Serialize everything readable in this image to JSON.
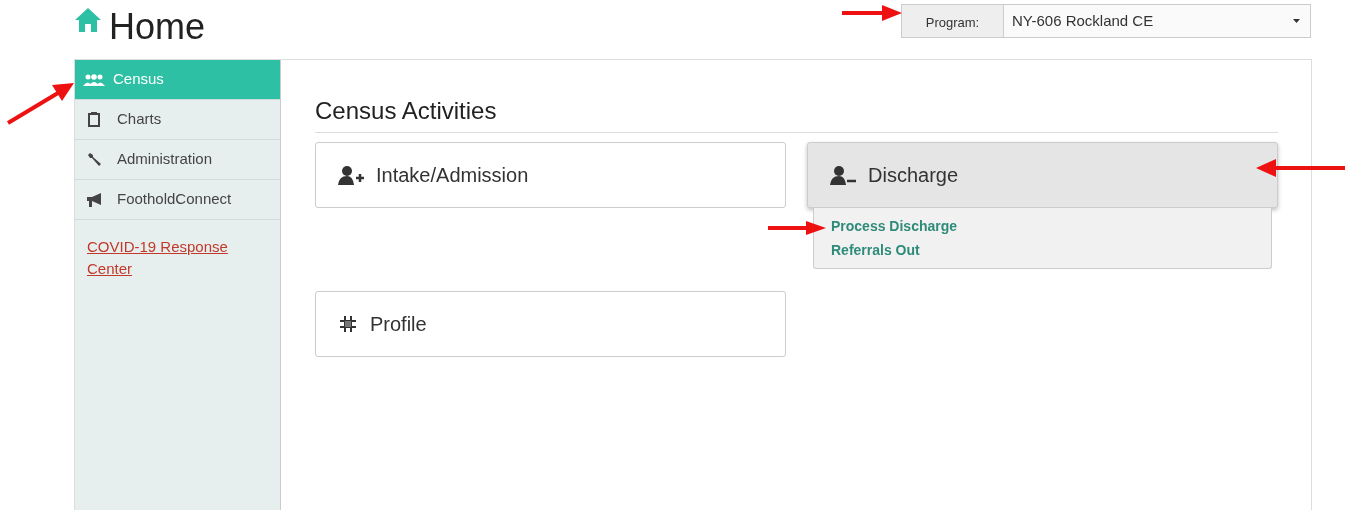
{
  "page": {
    "title": "Home"
  },
  "program_selector": {
    "label": "Program:",
    "value": "NY-606 Rockland CE"
  },
  "sidebar": {
    "items": [
      {
        "kind": "census",
        "label": "Census",
        "selected": true
      },
      {
        "kind": "charts",
        "label": "Charts",
        "selected": false
      },
      {
        "kind": "admin",
        "label": "Administration",
        "selected": false
      },
      {
        "kind": "connect",
        "label": "FootholdConnect",
        "selected": false
      }
    ],
    "link": "COVID-19 Response Center"
  },
  "section": {
    "title": "Census Activities",
    "cards": [
      {
        "kind": "add",
        "label": "Intake/Admission",
        "expanded": false
      },
      {
        "kind": "remove",
        "label": "Discharge",
        "expanded": true,
        "submenu": [
          "Process Discharge",
          "Referrals Out"
        ]
      },
      {
        "kind": "profile",
        "label": "Profile",
        "expanded": false
      }
    ]
  }
}
